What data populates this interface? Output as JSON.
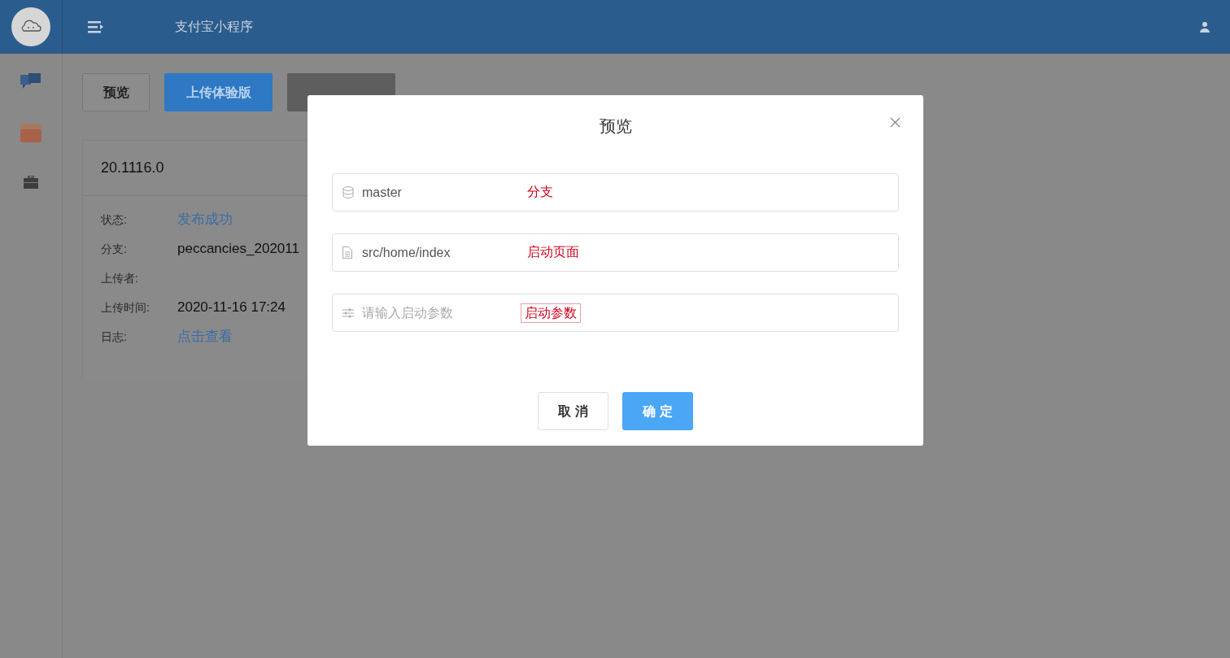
{
  "header": {
    "title": "支付宝小程序"
  },
  "toolbar": {
    "buttons": [
      {
        "label": "预览",
        "kind": "default"
      },
      {
        "label": "上传体验版",
        "kind": "primary"
      },
      {
        "kind": "secondary"
      }
    ]
  },
  "version_card": {
    "version": "20.1116.0",
    "fields": [
      {
        "label": "状态:",
        "value": "发布成功",
        "kind": "link"
      },
      {
        "label": "分支:",
        "value": "peccancies_202011",
        "kind": "text"
      },
      {
        "label": "上传者:"
      },
      {
        "label": "上传时间:",
        "value": "2020-11-16 17:24",
        "kind": "text"
      },
      {
        "label": "日志:",
        "value": "点击查看",
        "kind": "link"
      }
    ]
  },
  "dialog": {
    "title": "预览",
    "fields": [
      {
        "kind": "branch",
        "value": "master",
        "annotation": "分支",
        "annotation_boxed": false
      },
      {
        "kind": "file",
        "value": "src/home/index",
        "annotation": "启动页面",
        "annotation_boxed": false
      },
      {
        "kind": "params",
        "placeholder": "请输入启动参数",
        "annotation": "启动参数",
        "annotation_boxed": true
      }
    ],
    "buttons": [
      {
        "label": "取 消",
        "kind": "default"
      },
      {
        "label": "确 定",
        "kind": "primary"
      }
    ]
  }
}
